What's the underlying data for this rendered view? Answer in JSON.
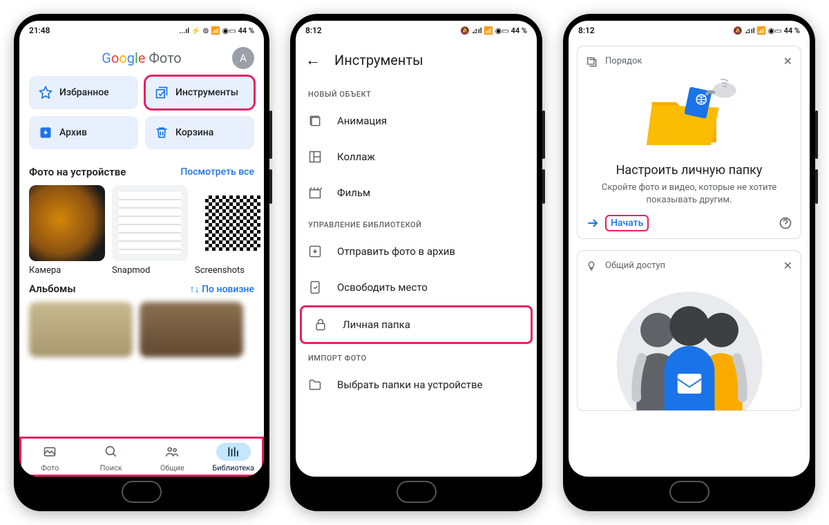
{
  "status": {
    "time1": "21:48",
    "time2": "8:12",
    "battery": "44 %"
  },
  "screen1": {
    "logo_suffix": "Фото",
    "avatar_letter": "A",
    "tiles": {
      "fav": "Избранное",
      "tools": "Инструменты",
      "archive": "Архив",
      "trash": "Корзина"
    },
    "device_photos": {
      "title": "Фото на устройстве",
      "link": "Посмотреть все",
      "albums": [
        "Камера",
        "Snapmod",
        "Screenshots"
      ]
    },
    "albums_section": {
      "title": "Альбомы",
      "sort": "По новизне"
    },
    "nav": {
      "photos": "Фото",
      "search": "Поиск",
      "shared": "Общие",
      "library": "Библиотека"
    }
  },
  "screen2": {
    "title": "Инструменты",
    "sec_new": "НОВЫЙ ОБЪЕКТ",
    "items_new": {
      "anim": "Анимация",
      "collage": "Коллаж",
      "movie": "Фильм"
    },
    "sec_manage": "УПРАВЛЕНИЕ БИБЛИОТЕКОЙ",
    "items_manage": {
      "archive": "Отправить фото в архив",
      "free": "Освободить место",
      "locked": "Личная папка"
    },
    "sec_import": "ИМПОРТ ФОТО",
    "items_import": {
      "choose": "Выбрать папки на устройстве"
    }
  },
  "screen3": {
    "card1": {
      "head": "Порядок",
      "title": "Настроить личную папку",
      "sub": "Скройте фото и видео, которые не хотите показывать другим.",
      "action": "Начать"
    },
    "card2": {
      "head": "Общий доступ"
    }
  }
}
